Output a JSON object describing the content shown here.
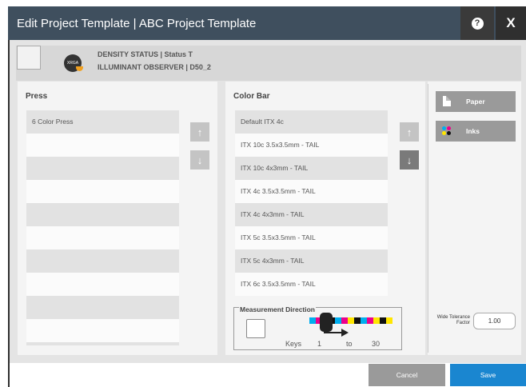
{
  "window": {
    "title": "Edit Project Template | ABC Project Template",
    "help_label": "?",
    "close_label": "X"
  },
  "status": {
    "logo_text": "XRGA",
    "density_line": "DENSITY STATUS | Status T",
    "illuminant_line": "ILLUMINANT OBSERVER | D50_2"
  },
  "press": {
    "title": "Press",
    "items": [
      "6 Color Press",
      "",
      "",
      "",
      "",
      "",
      "",
      "",
      "",
      "",
      ""
    ]
  },
  "color_bar": {
    "title": "Color Bar",
    "items": [
      "Default ITX 4c",
      "ITX 10c 3.5x3.5mm - TAIL",
      "ITX 10c 4x3mm - TAIL",
      "ITX 4c 3.5x3.5mm - TAIL",
      "ITX 4c 4x3mm - TAIL",
      "ITX 5c 3.5x3.5mm - TAIL",
      "ITX 5c 4x3mm - TAIL",
      "ITX 6c 3.5x3.5mm - TAIL"
    ]
  },
  "arrows": {
    "up": "↑",
    "down": "↓"
  },
  "side_buttons": {
    "paper": "Paper",
    "inks": "Inks"
  },
  "measurement": {
    "title": "Measurement Direction",
    "keys_label": "Keys",
    "from": "1",
    "to_label": "to",
    "to": "30",
    "bar_colors": [
      "#00aeef",
      "#ec008c",
      "#ffe600",
      "#111111",
      "#00aeef",
      "#ec008c",
      "#ffe600",
      "#111111",
      "#00aeef",
      "#ec008c",
      "#ffe600",
      "#111111",
      "#ffe600"
    ]
  },
  "tolerance": {
    "label": "Wide Tolerance Factor",
    "value": "1.00"
  },
  "footer": {
    "cancel": "Cancel",
    "save": "Save"
  },
  "colors": {
    "titlebar": "#3f4f5e",
    "save": "#1a86d0",
    "cancel": "#9a9a9a",
    "panel": "#f4f4f4"
  }
}
